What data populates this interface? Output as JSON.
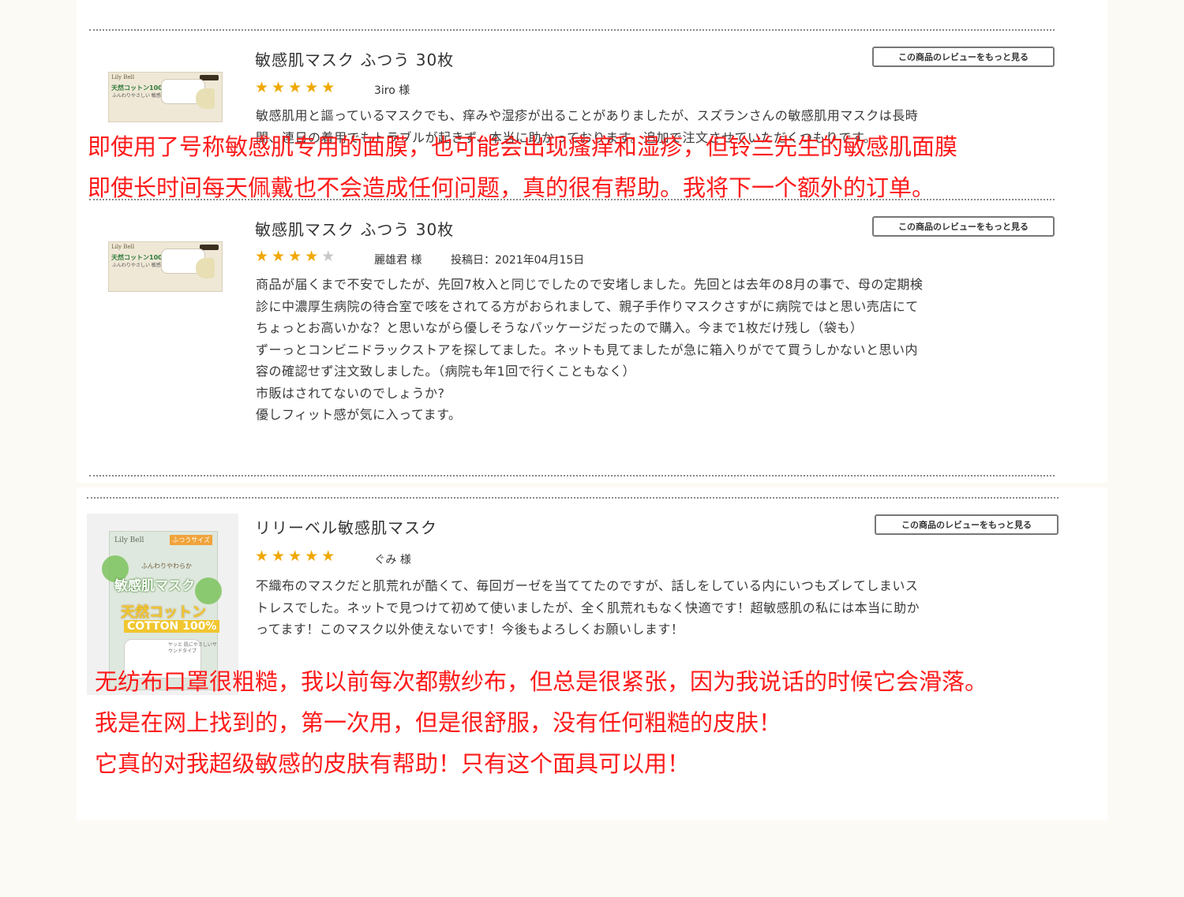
{
  "more_reviews_label": "この商品のレビューをもっと見る",
  "reviews": [
    {
      "product": "敏感肌マスク ふつう 30枚",
      "stars": 5,
      "reviewer": "3iro 様",
      "date": "",
      "lines": [
        "敏感肌用と謳っているマスクでも、痒みや湿疹が出ることがありましたが、スズランさんの敏感肌用マスクは長時",
        "間、連日の着用でもトラブルが起きず、本当に助かっております。追加で注文させていただくつもりです。"
      ]
    },
    {
      "product": "敏感肌マスク ふつう 30枚",
      "stars": 4,
      "reviewer": "麗雄君 様",
      "date": "投稿日：2021年04月15日",
      "lines": [
        "商品が届くまで不安でしたが、先回7枚入と同じでしたので安堵しました。先回とは去年の8月の事で、母の定期検",
        "診に中濃厚生病院の待合室で咳をされてる方がおられまして、親子手作りマスクさすがに病院ではと思い売店にて",
        "ちょっとお高いかな？と思いながら優しそうなパッケージだったので購入。今まで1枚だけ残し（袋も）",
        "ずーっとコンビニドラックストアを探してました。ネットも見てましたが急に箱入りがでて買うしかないと思い内",
        "容の確認せず注文致しました。（病院も年1回で行くこともなく）",
        "市販はされてないのでしょうか?",
        "優しフィット感が気に入ってます。"
      ]
    },
    {
      "product": "リリーベル敏感肌マスク",
      "stars": 5,
      "reviewer": "ぐみ 様",
      "date": "",
      "lines": [
        "不織布のマスクだと肌荒れが酷くて、毎回ガーゼを当ててたのですが、話しをしている内にいつもズレてしまいス",
        "トレスでした。ネットで見つけて初めて使いましたが、全く肌荒れもなく快適です！超敏感肌の私には本当に助か",
        "ってます！このマスク以外使えないです！今後もよろしくお願いします！"
      ]
    }
  ],
  "overlay_top": [
    "即使用了号称敏感肌专用的面膜，也可能会出现瘙痒和湿疹，但铃兰先生的敏感肌面膜",
    "即使长时间每天佩戴也不会造成任何问题，真的很有帮助。我将下一个额外的订单。"
  ],
  "overlay_bottom": [
    "无纺布口罩很粗糙，我以前每次都敷纱布，但总是很紧张，因为我说话的时候它会滑落。",
    "我是在网上找到的，第一次用，但是很舒服，没有任何粗糙的皮肤！",
    "它真的对我超级敏感的皮肤有帮助！只有这个面具可以用！"
  ],
  "package_small": {
    "brand": "Lily Bell",
    "title": "天然コットン100%",
    "subtitle": "ふんわりやさしい 敏感肌マスク"
  },
  "package_big": {
    "brand": "Lily Bell",
    "tag": "ふつうサイズ",
    "subtitle": "ふんわりやわらか",
    "title": "敏感肌マスク",
    "cotton": "天然コットン",
    "percent": "COTTON 100%",
    "note": "ヤッと 肌にやさしいサウンドタイプ"
  },
  "colors": {
    "overlay_text": "#ff1a1a",
    "star": "#f0a800",
    "star_empty": "#c8c8c8",
    "page_bg": "#fcfaf4"
  }
}
